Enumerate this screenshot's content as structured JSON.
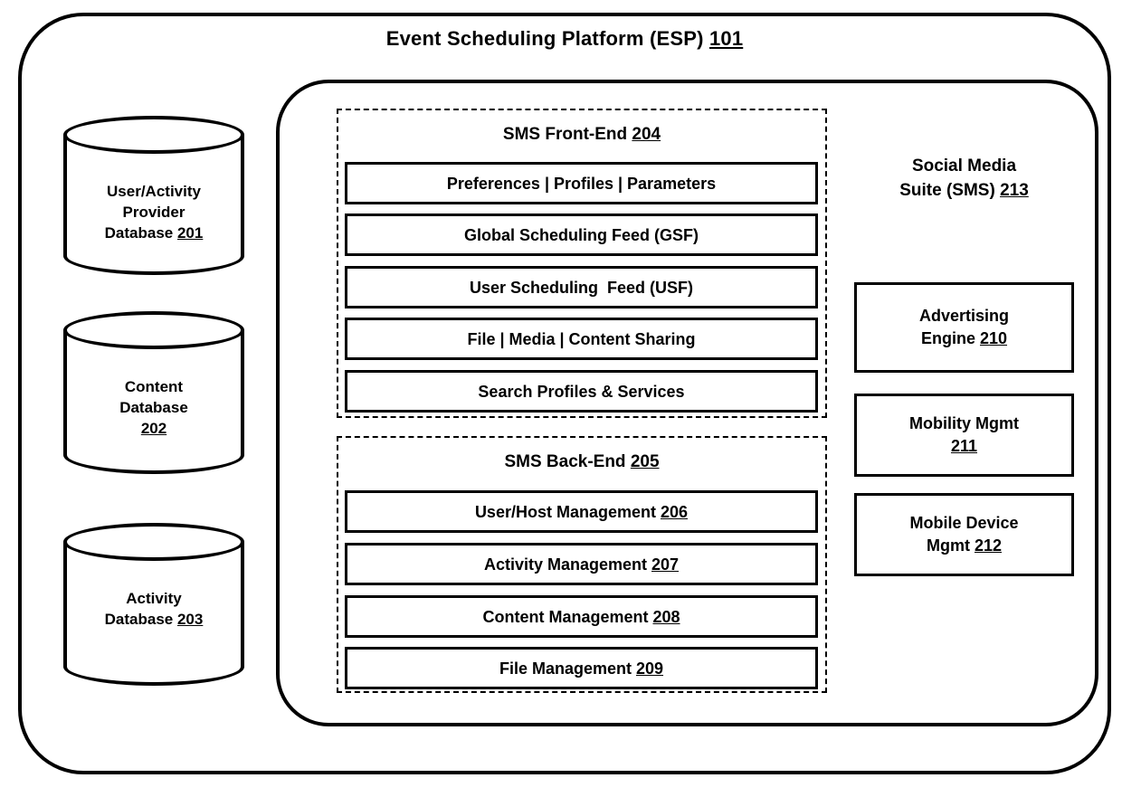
{
  "figure": {
    "platform": {
      "title_text": "Event Scheduling Platform (ESP) ",
      "title_ref": "101"
    },
    "databases": [
      {
        "name": "user-activity-provider-database",
        "lines": [
          "User/Activity",
          "Provider",
          "Database "
        ],
        "ref": "201",
        "ref_on_line": 2
      },
      {
        "name": "content-database",
        "lines": [
          "Content",
          "Database",
          ""
        ],
        "ref": "202",
        "ref_on_line": 2
      },
      {
        "name": "activity-database",
        "lines": [
          "Activity",
          "Database "
        ],
        "ref": "203",
        "ref_on_line": 1
      }
    ],
    "front_end": {
      "title_text": "SMS Front-End ",
      "title_ref": "204",
      "items": [
        {
          "name": "preferences-profiles-parameters",
          "label": "Preferences | Profiles | Parameters",
          "ref": ""
        },
        {
          "name": "global-scheduling-feed",
          "label": "Global Scheduling Feed (GSF)",
          "ref": ""
        },
        {
          "name": "user-scheduling-feed",
          "label": "User Scheduling  Feed (USF)",
          "ref": ""
        },
        {
          "name": "file-media-content-sharing",
          "label": "File | Media | Content Sharing",
          "ref": ""
        },
        {
          "name": "search-profiles-services",
          "label": "Search Profiles & Services",
          "ref": ""
        }
      ]
    },
    "back_end": {
      "title_text": "SMS Back-End ",
      "title_ref": "205",
      "items": [
        {
          "name": "user-host-management",
          "label": "User/Host Management ",
          "ref": "206"
        },
        {
          "name": "activity-management",
          "label": "Activity Management ",
          "ref": "207"
        },
        {
          "name": "content-management",
          "label": "Content Management ",
          "ref": "208"
        },
        {
          "name": "file-management",
          "label": "File Management ",
          "ref": "209"
        }
      ]
    },
    "social_media_suite": {
      "title_line1": "Social Media",
      "title_line2": "Suite (SMS) ",
      "title_ref": "213",
      "items": [
        {
          "name": "advertising-engine",
          "line1": "Advertising",
          "line2": "Engine ",
          "ref": "210"
        },
        {
          "name": "mobility-mgmt",
          "line1": "Mobility Mgmt",
          "line2": "",
          "ref": "211"
        },
        {
          "name": "mobile-device-mgmt",
          "line1": "Mobile Device",
          "line2": "Mgmt ",
          "ref": "212"
        }
      ]
    },
    "colors": {
      "stroke": "#000000",
      "background": "#ffffff"
    }
  }
}
